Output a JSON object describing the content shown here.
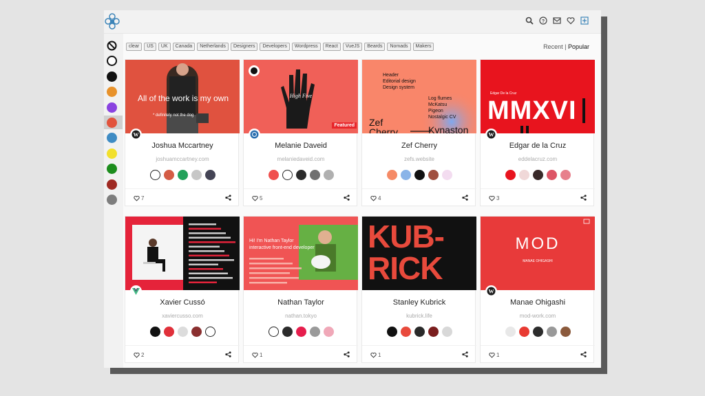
{
  "header": {
    "icons": [
      "search-icon",
      "help-icon",
      "mail-icon",
      "heart-icon",
      "add-icon"
    ]
  },
  "sidebar": {
    "swatches": [
      {
        "name": "none",
        "color": "none"
      },
      {
        "name": "white",
        "color": "#ffffff"
      },
      {
        "name": "black",
        "color": "#111111"
      },
      {
        "name": "orange",
        "color": "#e8922b"
      },
      {
        "name": "purple",
        "color": "#8a43e0"
      },
      {
        "name": "red",
        "color": "#e2533c",
        "selected": true
      },
      {
        "name": "blue",
        "color": "#3f8cc4"
      },
      {
        "name": "yellow",
        "color": "#f2e02d"
      },
      {
        "name": "green",
        "color": "#1d8d1d"
      },
      {
        "name": "dark-red",
        "color": "#9f2a23"
      },
      {
        "name": "gray",
        "color": "#7e7e7e"
      }
    ]
  },
  "filters": [
    "clear",
    "US",
    "UK",
    "Canada",
    "Netherlands",
    "Designers",
    "Developers",
    "Wordpress",
    "React",
    "VueJS",
    "Beards",
    "Nomads",
    "Makers"
  ],
  "sort": {
    "recent": "Recent",
    "separator": "|",
    "popular": "Popular"
  },
  "cards": [
    {
      "name": "Joshua Mccartney",
      "url": "joshuamccartney.com",
      "likes": "7",
      "platform": "wordpress",
      "colors": [
        "#ffffff",
        "#d45c45",
        "#22a15a",
        "#c7c7c7",
        "#444455"
      ],
      "thumb": {
        "bg": "#e0523f",
        "headline": "All of the work is my own",
        "sub": "* definitely not the dog"
      }
    },
    {
      "name": "Melanie Daveid",
      "url": "melaniedaveid.com",
      "likes": "5",
      "platform": "other",
      "colors": [
        "#f0504e",
        "#ffffff",
        "#2b2b2b",
        "#707070",
        "#b0b0b0"
      ],
      "thumb": {
        "bg": "#f06058",
        "handtext": "High Five",
        "badge": "Featured"
      }
    },
    {
      "name": "Zef Cherry",
      "url": "zefs.website",
      "likes": "4",
      "platform": "none",
      "colors": [
        "#f58a66",
        "#8ab4e8",
        "#111111",
        "#a05040",
        "#f3dcf0"
      ],
      "thumb": {
        "bg": "#f9866a",
        "lines": [
          "Header",
          "Editorial design",
          "Design system"
        ],
        "lines2": [
          "Log flumes",
          "McKatsu",
          "Pigeon",
          "Nostalgic CV"
        ],
        "big": "Zef Cherry",
        "big2": "Kynaston"
      }
    },
    {
      "name": "Edgar de la Cruz",
      "url": "eddelacruz.com",
      "likes": "3",
      "platform": "wordpress",
      "colors": [
        "#e8141e",
        "#f0d8d8",
        "#3a2a2a",
        "#dd5566",
        "#e7808c"
      ],
      "thumb": {
        "bg": "#e8141e",
        "small": "Edgar De la Cruz",
        "big": "MMXVI"
      }
    },
    {
      "name": "Xavier Cussó",
      "url": "xaviercusso.com",
      "likes": "2",
      "platform": "vue",
      "colors": [
        "#111111",
        "#e0303a",
        "#dcdcdc",
        "#8a2f2f",
        "#ffffff"
      ],
      "thumb": {
        "bg": "#e5233a"
      }
    },
    {
      "name": "Nathan Taylor",
      "url": "nathan.tokyo",
      "likes": "1",
      "platform": "none",
      "colors": [
        "#ffffff",
        "#2b2b2b",
        "#e61e4d",
        "#9a9a9a",
        "#f0a8b8"
      ],
      "thumb": {
        "bg": "#f05454",
        "line1": "Hi! I'm Nathan Taylor",
        "line2": "interactive front-end developer"
      }
    },
    {
      "name": "Stanley Kubrick",
      "url": "kubrick.life",
      "likes": "1",
      "platform": "none",
      "colors": [
        "#111111",
        "#e84a3c",
        "#2a2a2a",
        "#7a1e1e",
        "#d8d8d8"
      ],
      "thumb": {
        "bg": "#111111",
        "big1": "KUB-",
        "big2": "RICK"
      }
    },
    {
      "name": "Manae Ohigashi",
      "url": "mod-work.com",
      "likes": "1",
      "platform": "wordpress",
      "colors": [
        "#e8e8e8",
        "#e83a32",
        "#2c2c2c",
        "#999999",
        "#8b5a3c"
      ],
      "thumb": {
        "bg": "#e83a3a",
        "big": "MOD",
        "small": "MANAE OHIGASHI"
      }
    }
  ]
}
